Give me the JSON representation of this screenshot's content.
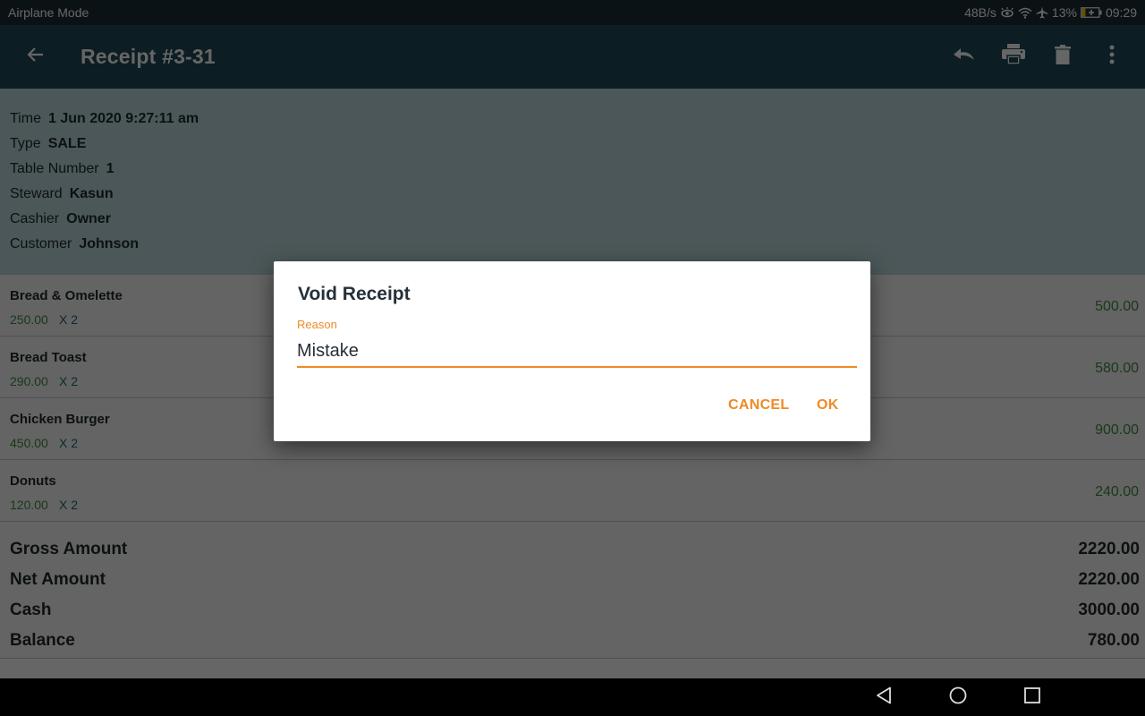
{
  "status_bar": {
    "left_text": "Airplane Mode",
    "net_speed": "48B/s",
    "battery": "13%",
    "time": "09:29",
    "icons": [
      "eye-comfort-icon",
      "wifi-icon",
      "airplane-icon",
      "battery-charging-icon"
    ]
  },
  "app_bar": {
    "title": "Receipt #3-31",
    "back_icon": "arrow-back-icon",
    "actions": [
      "undo-icon",
      "print-icon",
      "delete-icon",
      "more-vert-icon"
    ]
  },
  "receipt_info": [
    {
      "label": "Time",
      "value": "1 Jun 2020 9:27:11 am"
    },
    {
      "label": "Type",
      "value": "SALE"
    },
    {
      "label": "Table Number",
      "value": "1"
    },
    {
      "label": "Steward",
      "value": "Kasun"
    },
    {
      "label": "Cashier",
      "value": "Owner"
    },
    {
      "label": "Customer",
      "value": "Johnson"
    }
  ],
  "items": [
    {
      "name": "Bread & Omelette",
      "price": "250.00",
      "qty": "X 2",
      "total": "500.00"
    },
    {
      "name": "Bread Toast",
      "price": "290.00",
      "qty": "X 2",
      "total": "580.00"
    },
    {
      "name": "Chicken Burger",
      "price": "450.00",
      "qty": "X 2",
      "total": "900.00"
    },
    {
      "name": "Donuts",
      "price": "120.00",
      "qty": "X 2",
      "total": "240.00"
    }
  ],
  "totals": [
    {
      "label": "Gross Amount",
      "value": "2220.00"
    },
    {
      "label": "Net Amount",
      "value": "2220.00"
    },
    {
      "label": "Cash",
      "value": "3000.00"
    },
    {
      "label": "Balance",
      "value": "780.00"
    }
  ],
  "dialog": {
    "title": "Void Receipt",
    "field_label": "Reason",
    "field_value": "Mistake",
    "cancel_label": "CANCEL",
    "ok_label": "OK"
  },
  "nav_bar": {
    "buttons": [
      "back-triangle-icon",
      "home-circle-icon",
      "recents-square-icon"
    ]
  },
  "colors": {
    "app_bar": "#1f4a58",
    "accent": "#ef8a25",
    "price_green": "#3f8e3f",
    "qty_teal": "#1f6a7a",
    "info_bg": "#bbd9dd"
  }
}
